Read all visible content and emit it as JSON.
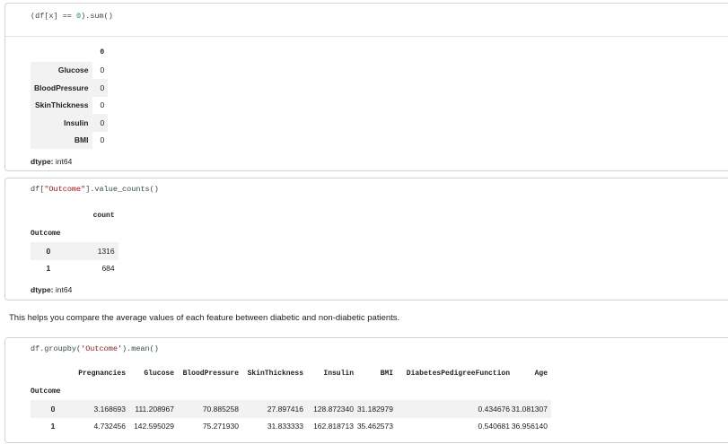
{
  "cell1": {
    "code": "(df[x] == 0).sum()",
    "col_header": "0",
    "rows": [
      {
        "label": "Glucose",
        "value": "0"
      },
      {
        "label": "BloodPressure",
        "value": "0"
      },
      {
        "label": "SkinThickness",
        "value": "0"
      },
      {
        "label": "Insulin",
        "value": "0"
      },
      {
        "label": "BMI",
        "value": "0"
      }
    ],
    "dtype_label": "dtype:",
    "dtype_value": "int64"
  },
  "cell2": {
    "code": "df[\"Outcome\"].value_counts()",
    "col_header": "count",
    "index_name": "Outcome",
    "rows": [
      {
        "label": "0",
        "value": "1316"
      },
      {
        "label": "1",
        "value": "684"
      }
    ],
    "dtype_label": "dtype:",
    "dtype_value": "int64"
  },
  "markdown": "This helps you compare the average values of each feature between diabetic and non-diabetic patients.",
  "cell3": {
    "code": "df.groupby('Outcome').mean()",
    "columns": [
      "Pregnancies",
      "Glucose",
      "BloodPressure",
      "SkinThickness",
      "Insulin",
      "BMI",
      "DiabetesPedigreeFunction",
      "Age"
    ],
    "index_name": "Outcome",
    "rows": [
      {
        "label": "0",
        "values": [
          "3.168693",
          "111.208967",
          "70.885258",
          "27.897416",
          "128.872340",
          "31.182979",
          "0.434676",
          "31.081307"
        ]
      },
      {
        "label": "1",
        "values": [
          "4.732456",
          "142.595029",
          "75.271930",
          "31.833333",
          "162.818713",
          "35.462573",
          "0.540681",
          "36.956140"
        ]
      }
    ]
  }
}
